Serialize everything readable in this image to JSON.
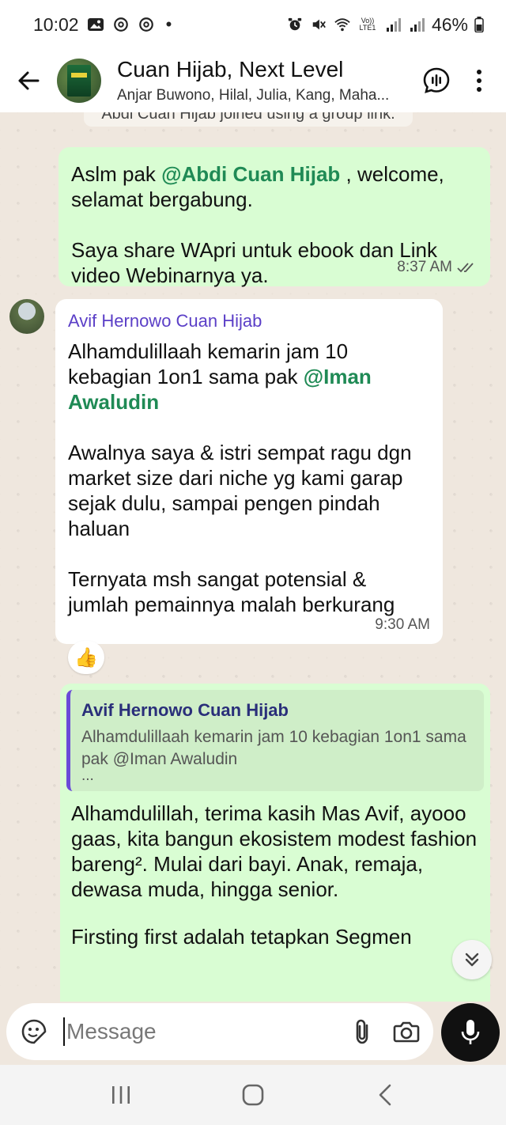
{
  "status": {
    "time": "10:02",
    "battery": "46%",
    "left_icons": [
      "gallery-icon",
      "threads-icon",
      "threads-icon"
    ],
    "right_icons": [
      "alarm-icon",
      "mute-icon",
      "wifi-icon",
      "volte-icon",
      "signal-icon",
      "signal-icon",
      "battery-icon"
    ],
    "volte_label": "Vo)) LTE1"
  },
  "header": {
    "title": "Cuan Hijab, Next Level",
    "members": "Anjar Buwono, Hilal, Julia, Kang, Maha..."
  },
  "messages": {
    "system": "Abdi Cuan Hijab joined using a group link.",
    "m1": {
      "prefix": "Aslm pak ",
      "mention": "@Abdi Cuan Hijab",
      "text": " , welcome, selamat bergabung.\n\nSaya share WApri untuk ebook dan Link video Webinarnya ya.",
      "time": "8:37 AM"
    },
    "m2": {
      "sender": "Avif Hernowo Cuan Hijab",
      "prefix": "Alhamdulillaah kemarin jam 10 kebagian 1on1 sama pak ",
      "mention": "@Iman Awaludin",
      "text": "\n\nAwalnya saya & istri sempat ragu dgn market size dari niche yg kami garap sejak dulu, sampai pengen pindah haluan\n\nTernyata msh sangat potensial & jumlah pemainnya malah berkurang",
      "time": "9:30 AM",
      "reaction": "👍"
    },
    "m3": {
      "quote_sender": "Avif Hernowo Cuan Hijab",
      "quote_text": "Alhamdulillaah kemarin jam 10 kebagian 1on1 sama pak @Iman Awaludin",
      "quote_ellipsis": "...",
      "text": "Alhamdulillah, terima kasih Mas Avif, ayooo gaas, kita bangun ekosistem modest fashion bareng². Mulai dari bayi. Anak, remaja, dewasa muda, hingga senior.",
      "cut_text": "Firsting first adalah tetapkan Segmen"
    }
  },
  "input": {
    "placeholder": "Message"
  },
  "colors": {
    "outgoing": "#d9fdd3",
    "incoming": "#ffffff",
    "mention": "#1f8a55",
    "sender": "#5b3fc7",
    "background": "#efe7de"
  }
}
